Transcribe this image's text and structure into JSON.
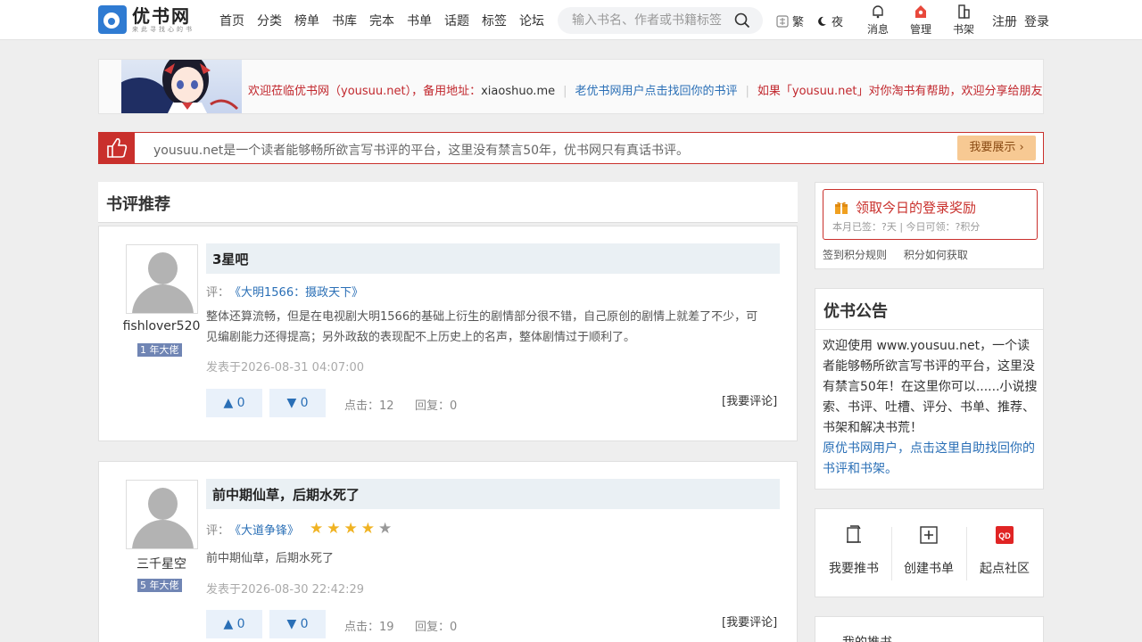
{
  "header": {
    "logo_title": "优书网",
    "logo_sub": "来此寻找心的书",
    "nav": [
      "首页",
      "分类",
      "榜单",
      "书库",
      "完本",
      "书单",
      "话题",
      "标签",
      "论坛"
    ],
    "search_placeholder": "输入书名、作者或书籍标签",
    "traditional_label": "繁",
    "night_label": "夜",
    "messages_label": "消息",
    "manage_label": "管理",
    "shelf_label": "书架",
    "register_label": "注册",
    "login_label": "登录"
  },
  "notice": {
    "welcome": "欢迎莅临优书网（yousuu.net），备用地址：",
    "backup": "xiaoshuo.me",
    "old_users": "老优书网用户点击找回你的书评",
    "share": "如果「yousuu.net」对你淘书有帮助，欢迎分享给朋友"
  },
  "slogan": {
    "text": "yousuu.net是一个读者能够畅所欲言写书评的平台，这里没有禁言50年，优书网只有真话书评。",
    "button": "我要展示"
  },
  "reviews_header": "书评推荐",
  "reviews": [
    {
      "username": "fishlover520",
      "level": "1 年大佬",
      "title": "3星吧",
      "prefix": "评：",
      "book": "《大明1566：摄政天下》",
      "stars": null,
      "body": "整体还算流畅，但是在电视剧大明1566的基础上衍生的剧情部分很不错，自己原创的剧情上就差了不少，可见编剧能力还得提高；另外政敌的表现配不上历史上的名声，整体剧情过于顺利了。",
      "time": "发表于2026-08-31 04:07:00",
      "up": "▲  0",
      "down": "▼  0",
      "clicks": "点击：12",
      "replies": "回复：0",
      "reply_btn": "[我要评论]"
    },
    {
      "username": "三千星空",
      "level": "5 年大佬",
      "title": "前中期仙草，后期水死了",
      "prefix": "评：",
      "book": "《大道争锋》",
      "stars": 4,
      "body": "前中期仙草，后期水死了",
      "time": "发表于2026-08-30 22:42:29",
      "up": "▲  0",
      "down": "▼  0",
      "clicks": "点击：19",
      "replies": "回复：0",
      "reply_btn": "[我要评论]"
    }
  ],
  "reward": {
    "title": "领取今日的登录奖励",
    "sub": "本月已签：?天 | 今日可领：?积分",
    "rule": "签到积分规则",
    "how": "积分如何获取"
  },
  "announcement": {
    "title": "优书公告",
    "text": "欢迎使用 www.yousuu.net，一个读者能够畅所欲言写书评的平台，这里没有禁言50年！在这里你可以......小说搜索、书评、吐槽、评分、书单、推荐、书架和解决书荒！",
    "link": "原优书网用户，点击这里自助找回你的书评和书架。"
  },
  "tools": [
    "我要推书",
    "创建书单",
    "起点社区"
  ],
  "my_recommend": "我的推书",
  "colors": {
    "accent_red": "#c9302c",
    "link_blue": "#2a6fb6",
    "star_gold": "#f0b323"
  }
}
